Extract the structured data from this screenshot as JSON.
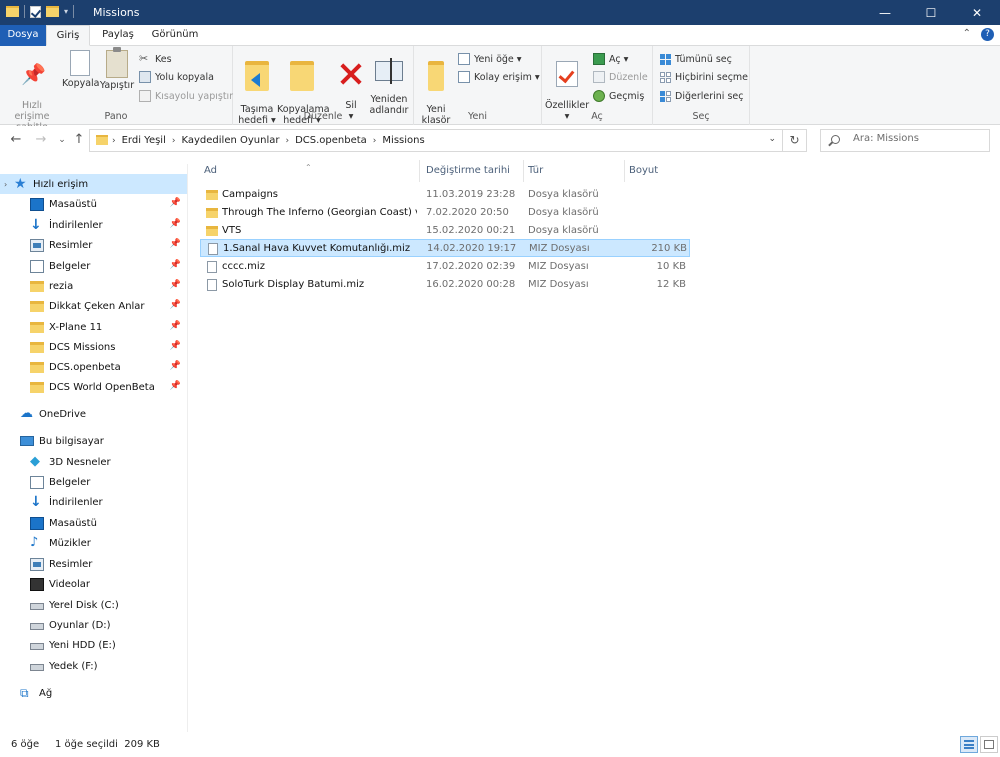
{
  "window": {
    "title": "Missions",
    "controls": {
      "minimize": "—",
      "maximize": "☐",
      "close": "✕"
    }
  },
  "tabs": {
    "file": "Dosya",
    "home": "Giriş",
    "share": "Paylaş",
    "view": "Görünüm"
  },
  "ribbon": {
    "clipboard": {
      "label": "Pano",
      "pin": "Hızlı erişime\nsabitle",
      "copy": "Kopyala",
      "paste": "Yapıştır",
      "cut": "Kes",
      "copy_path": "Yolu kopyala",
      "paste_shortcut": "Kısayolu yapıştır"
    },
    "organize": {
      "label": "Düzenle",
      "move_to": "Taşıma\nhedefi ▾",
      "copy_to": "Kopyalama\nhedefi ▾",
      "delete": "Sil\n▾",
      "rename": "Yeniden\nadlandır"
    },
    "new": {
      "label": "Yeni",
      "new_folder": "Yeni\nklasör",
      "new_item": "Yeni öğe ▾",
      "easy_access": "Kolay erişim ▾"
    },
    "open": {
      "label": "Aç",
      "properties": "Özellikler\n▾",
      "open": "Aç ▾",
      "edit": "Düzenle",
      "history": "Geçmiş"
    },
    "select": {
      "label": "Seç",
      "select_all": "Tümünü seç",
      "select_none": "Hiçbirini seçme",
      "invert": "Diğerlerini seç"
    }
  },
  "address": {
    "crumbs": [
      "Erdi Yeşil",
      "Kaydedilen Oyunlar",
      "DCS.openbeta",
      "Missions"
    ]
  },
  "search": {
    "placeholder": "Ara: Missions"
  },
  "navpane": {
    "quick_access": "Hızlı erişim",
    "quick_items": [
      {
        "label": "Masaüstü",
        "icon": "desktop-icon"
      },
      {
        "label": "İndirilenler",
        "icon": "download-icon"
      },
      {
        "label": "Resimler",
        "icon": "pictures-icon"
      },
      {
        "label": "Belgeler",
        "icon": "documents-icon"
      },
      {
        "label": "rezia",
        "icon": "folder-icon"
      },
      {
        "label": "Dikkat Çeken Anlar",
        "icon": "folder-icon"
      },
      {
        "label": "X-Plane 11",
        "icon": "folder-icon"
      },
      {
        "label": "DCS Missions",
        "icon": "folder-icon"
      },
      {
        "label": "DCS.openbeta",
        "icon": "folder-icon"
      },
      {
        "label": "DCS World OpenBeta",
        "icon": "folder-icon"
      }
    ],
    "onedrive": "OneDrive",
    "this_pc": "Bu bilgisayar",
    "pc_items": [
      {
        "label": "3D Nesneler",
        "icon": "3d-objects-icon"
      },
      {
        "label": "Belgeler",
        "icon": "documents-icon"
      },
      {
        "label": "İndirilenler",
        "icon": "download-icon"
      },
      {
        "label": "Masaüstü",
        "icon": "desktop-icon"
      },
      {
        "label": "Müzikler",
        "icon": "music-icon"
      },
      {
        "label": "Resimler",
        "icon": "pictures-icon"
      },
      {
        "label": "Videolar",
        "icon": "videos-icon"
      },
      {
        "label": "Yerel Disk (C:)",
        "icon": "drive-icon"
      },
      {
        "label": "Oyunlar (D:)",
        "icon": "drive-icon"
      },
      {
        "label": "Yeni HDD (E:)",
        "icon": "drive-icon"
      },
      {
        "label": "Yedek (F:)",
        "icon": "drive-icon"
      }
    ],
    "network": "Ağ"
  },
  "filelist": {
    "columns": {
      "name": "Ad",
      "modified": "Değiştirme tarihi",
      "type": "Tür",
      "size": "Boyut"
    },
    "rows": [
      {
        "name": "Campaigns",
        "modified": "11.03.2019 23:28",
        "type": "Dosya klasörü",
        "size": "",
        "kind": "folder"
      },
      {
        "name": "Through The Inferno (Georgian Coast) v1...",
        "modified": "7.02.2020 20:50",
        "type": "Dosya klasörü",
        "size": "",
        "kind": "folder"
      },
      {
        "name": "VTS",
        "modified": "15.02.2020 00:21",
        "type": "Dosya klasörü",
        "size": "",
        "kind": "folder"
      },
      {
        "name": "1.Sanal Hava Kuvvet Komutanlığı.miz",
        "modified": "14.02.2020 19:17",
        "type": "MIZ Dosyası",
        "size": "210 KB",
        "kind": "file",
        "selected": true
      },
      {
        "name": "cccc.miz",
        "modified": "17.02.2020 02:39",
        "type": "MIZ Dosyası",
        "size": "10 KB",
        "kind": "file"
      },
      {
        "name": "SoloTurk Display Batumi.miz",
        "modified": "16.02.2020 00:28",
        "type": "MIZ Dosyası",
        "size": "12 KB",
        "kind": "file"
      }
    ]
  },
  "status": {
    "count": "6 öğe",
    "selected": "1 öğe seçildi  209 KB"
  }
}
